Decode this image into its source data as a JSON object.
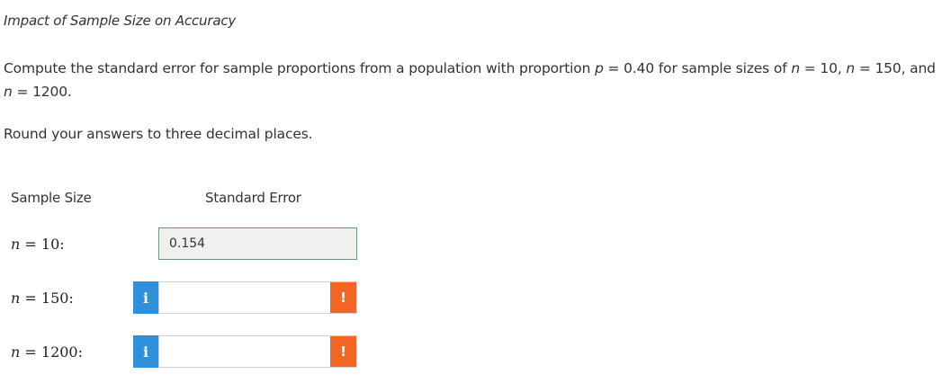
{
  "header": {
    "title": "Impact of Sample Size on Accuracy"
  },
  "question": {
    "prompt_part1": "Compute the standard error for sample proportions from a population with proportion ",
    "p_var": "p",
    "prompt_part2": " = 0.40 for sample sizes of ",
    "n_var1": "n",
    "prompt_part3": " = 10, ",
    "n_var2": "n",
    "prompt_part4": " = 150, and ",
    "n_var3": "n",
    "prompt_part5": " = 1200.",
    "rounding": "Round your answers to three decimal places."
  },
  "table": {
    "col_sample_size": "Sample Size",
    "col_standard_error": "Standard Error",
    "rows": [
      {
        "n_var": "n",
        "label": " = 10:",
        "value": "0.154",
        "status": "answered"
      },
      {
        "n_var": "n",
        "label": " = 150:",
        "value": "",
        "status": "empty",
        "info_glyph": "i",
        "alert_glyph": "!"
      },
      {
        "n_var": "n",
        "label": " = 1200:",
        "value": "",
        "status": "empty",
        "info_glyph": "i",
        "alert_glyph": "!"
      }
    ]
  },
  "icons": {
    "info": "info-icon",
    "alert": "exclamation-icon"
  },
  "colors": {
    "info_blue": "#2f8fd8",
    "alert_orange": "#f26522",
    "answered_border": "#6a9a78",
    "answered_bg": "#eef1ee"
  }
}
